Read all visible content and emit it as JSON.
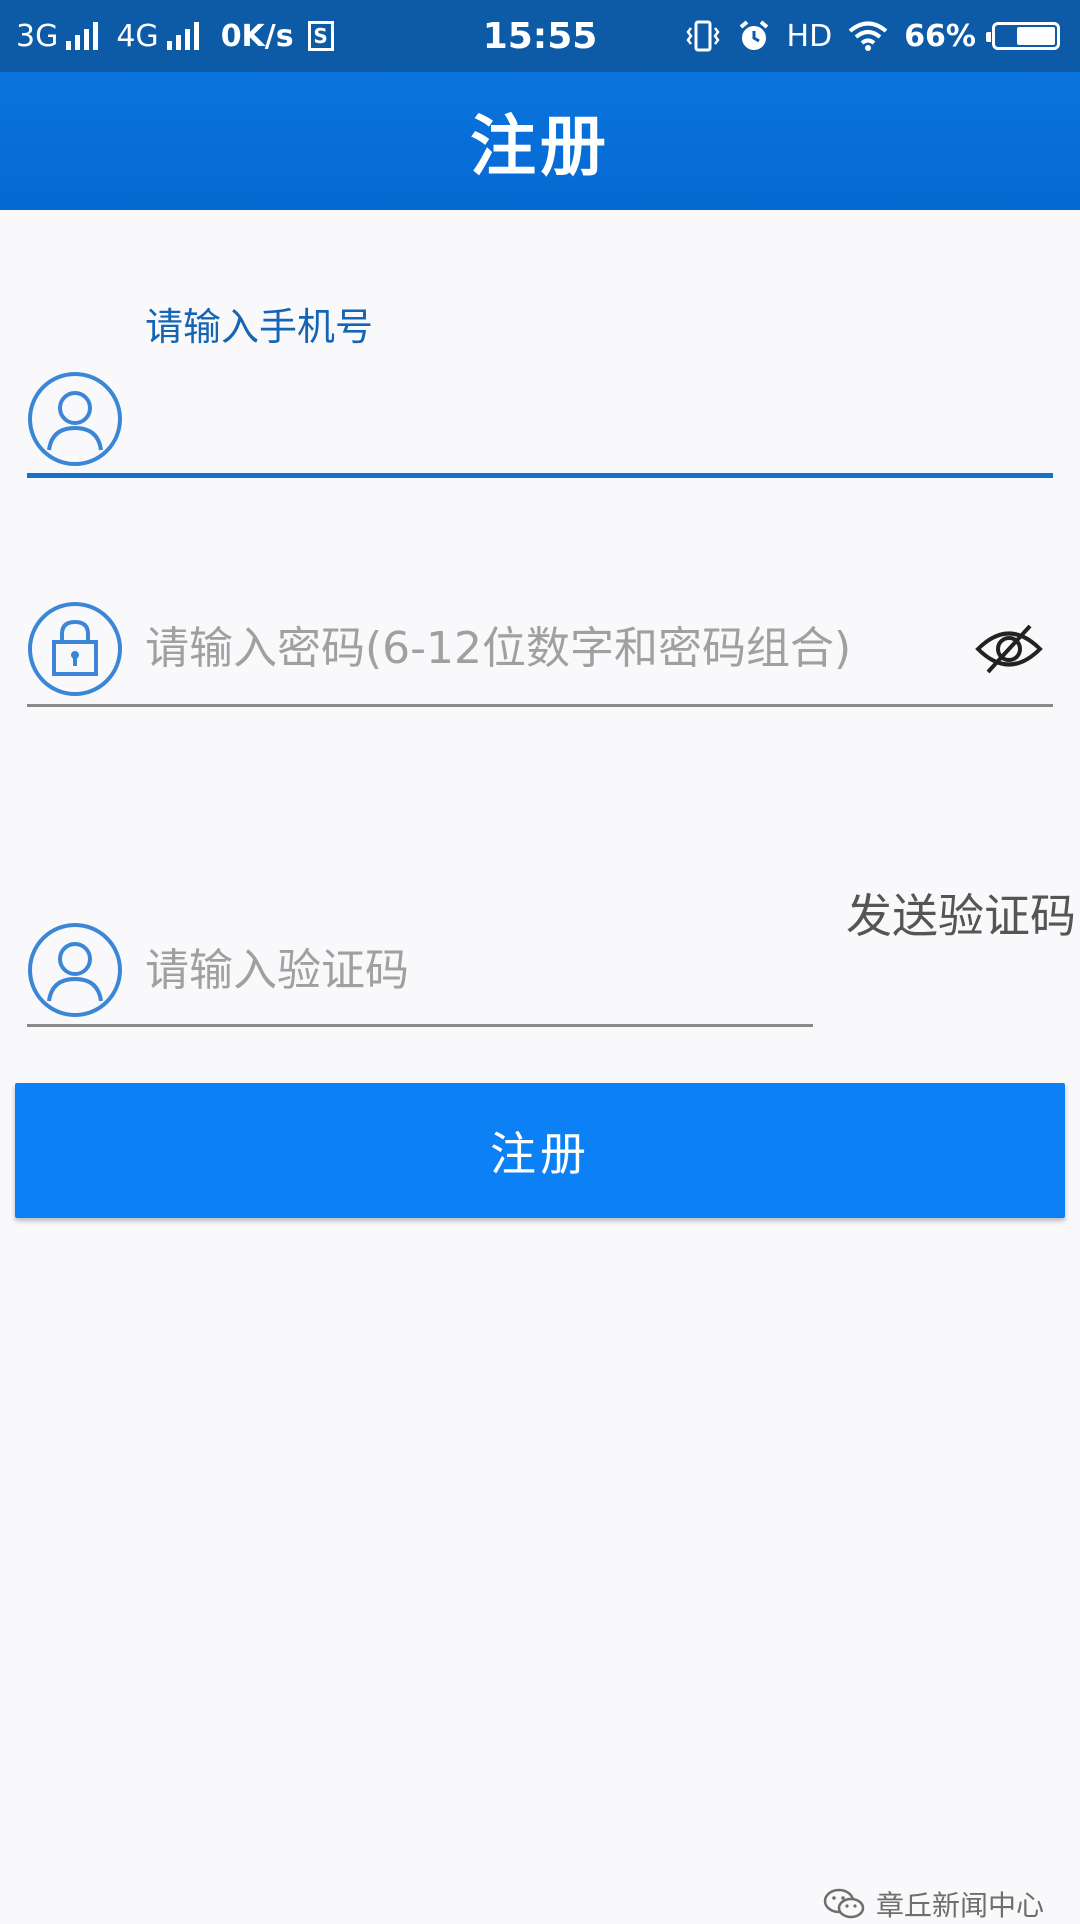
{
  "status_bar": {
    "network_1": "3G",
    "network_2": "4G",
    "speed": "0K/s",
    "s_badge": "S",
    "time": "15:55",
    "hd": "HD",
    "battery_percent": "66%",
    "battery_level": 0.66,
    "icons": [
      "signal-icon",
      "signal-icon",
      "vibrate-icon",
      "alarm-icon",
      "wifi-icon",
      "battery-icon"
    ]
  },
  "header": {
    "title": "注册"
  },
  "form": {
    "phone": {
      "label": "请输入手机号",
      "value": "",
      "icon": "user-icon"
    },
    "password": {
      "placeholder": "请输入密码(6-12位数字和密码组合)",
      "icon": "lock-icon",
      "toggle_icon": "eye-off-icon"
    },
    "code": {
      "placeholder": "请输入验证码",
      "icon": "user-icon",
      "send_label": "发送验证码"
    },
    "submit_label": "注册"
  },
  "watermark": {
    "text": "章丘新闻中心",
    "icon": "wechat-icon"
  },
  "colors": {
    "status_bar": "#0d5aa6",
    "header": "#0a74dd",
    "accent": "#1672c9",
    "button": "#0c81f5"
  }
}
